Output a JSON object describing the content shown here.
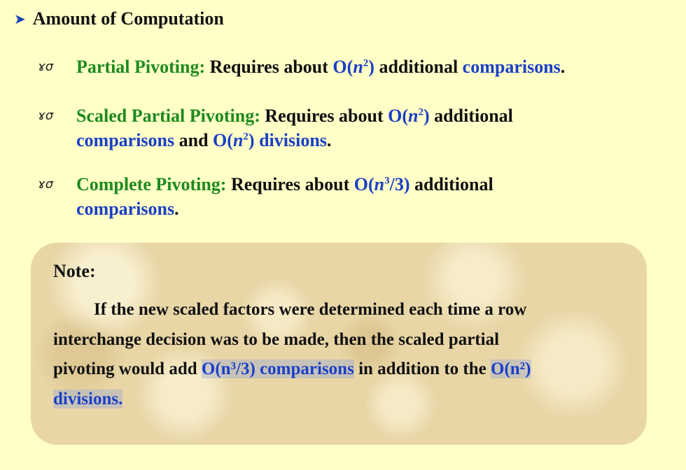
{
  "heading": {
    "arrow": "➤",
    "text": "Amount of Computation"
  },
  "bullet_symbol": "ɤσ",
  "items": [
    {
      "label": "Partial Pivoting:",
      "text1": " Requires about ",
      "big_o": "O(",
      "var": "n",
      "exp": "2",
      "close": ")",
      "text2": " additional ",
      "term": "comparisons",
      "tail": "."
    },
    {
      "label": "Scaled Partial Pivoting:",
      "text1": " Requires about ",
      "big_o": "O(",
      "var": "n",
      "exp": "2",
      "close": ")",
      "text2": " additional",
      "term": "comparisons",
      "and": " and ",
      "big_o2": "O(",
      "var2": "n",
      "exp2": "2",
      "close2": ")",
      "term2": " divisions",
      "tail": "."
    },
    {
      "label": "Complete Pivoting:",
      "text1": " Requires about ",
      "big_o": "O(",
      "var": "n",
      "exp": "3",
      "close": "/3)",
      "text2": " additional",
      "term": "comparisons",
      "tail": "."
    }
  ],
  "note": {
    "title": "Note:",
    "line1": "If the new scaled factors were determined each time a row",
    "line2": "interchange decision was to be made, then the scaled partial",
    "line3a": "pivoting would add ",
    "hl1": "O(n³/3) comparisons",
    "line3b": " in addition to the ",
    "hl2": "O(n²)",
    "hl3": "divisions."
  }
}
